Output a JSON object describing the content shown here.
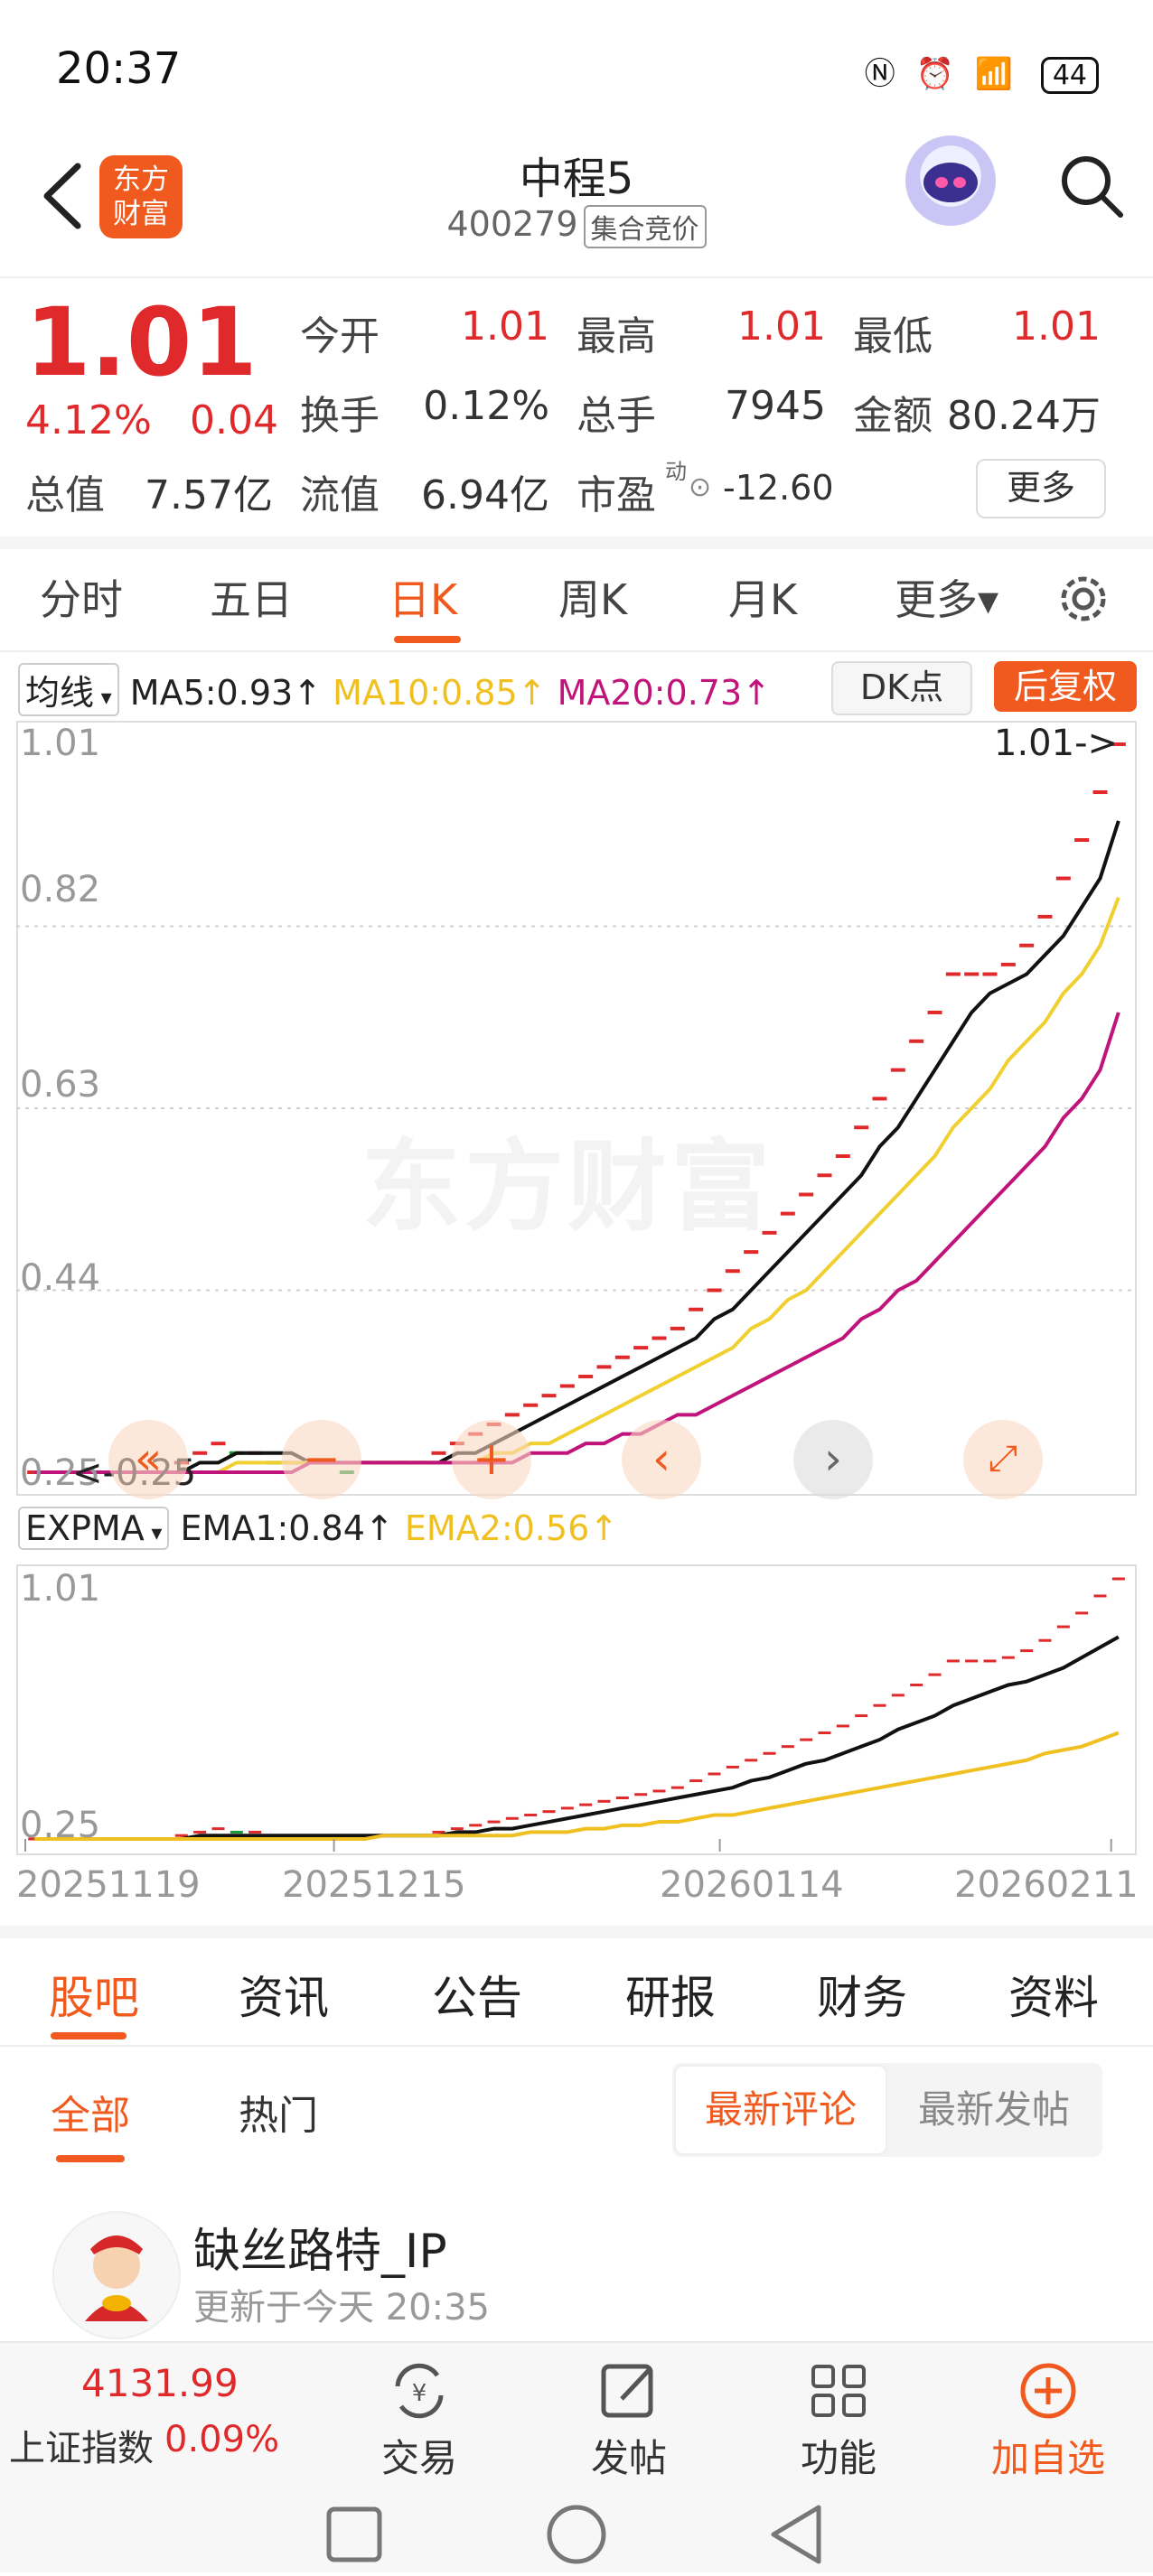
{
  "status_bar": {
    "time": "20:37",
    "battery": "44",
    "icons": [
      "nfc-icon",
      "alarm-icon",
      "wifi-icon",
      "signal-5g-icon",
      "battery-icon"
    ]
  },
  "header": {
    "stock_name": "中程5",
    "stock_code": "400279",
    "auction_tag": "集合竞价",
    "logo_line1": "东方",
    "logo_line2": "财富"
  },
  "quote": {
    "price": "1.01",
    "change_pct": "4.12%",
    "change_amt": "0.04",
    "open_label": "今开",
    "open": "1.01",
    "high_label": "最高",
    "high": "1.01",
    "low_label": "最低",
    "low": "1.01",
    "turnover_label": "换手",
    "turnover": "0.12%",
    "volume_label": "总手",
    "volume": "7945",
    "amount_label": "金额",
    "amount": "80.24万",
    "mktcap_label": "总值",
    "mktcap": "7.57亿",
    "float_label": "流值",
    "float_cap": "6.94亿",
    "pe_label": "市盈",
    "pe_sup": "动",
    "pe": "-12.60",
    "more": "更多"
  },
  "period_tabs": [
    "分时",
    "五日",
    "日K",
    "周K",
    "月K",
    "更多▾"
  ],
  "ma_row": {
    "selector": "均线",
    "ma5": "MA5:0.93↑",
    "ma10": "MA10:0.85↑",
    "ma20": "MA20:0.73↑",
    "dk": "DK点",
    "adjust": "后复权"
  },
  "kline_chart": {
    "y_labels": [
      "1.01",
      "0.82",
      "0.63",
      "0.44",
      "0.25"
    ],
    "last_price_tag": "1.01->",
    "low_tag": "<-0.25",
    "watermark": "东方财富",
    "colors": {
      "up": "#e0292b",
      "down": "#1a9a3a",
      "ma5": "#111111",
      "ma10": "#f0d030",
      "ma20": "#c0147a"
    }
  },
  "expma_row": {
    "selector": "EXPMA",
    "ema1": "EMA1:0.84↑",
    "ema2": "EMA2:0.56↑"
  },
  "expma_chart": {
    "y_labels": [
      "1.01",
      "0.25"
    ],
    "dates": [
      "20251119",
      "20251215",
      "20260114",
      "20260211"
    ],
    "colors": {
      "ema1": "#111111",
      "ema2": "#f0c020"
    }
  },
  "chart_data": {
    "type": "line",
    "title": "",
    "xlabel": "",
    "ylabel": "",
    "ylim": [
      0.25,
      1.01
    ],
    "x_ticks": [
      "20251119",
      "20251215",
      "20260114",
      "20260211"
    ],
    "candles": [
      0.25,
      0.25,
      0.25,
      0.25,
      0.25,
      0.25,
      0.25,
      0.25,
      0.26,
      0.27,
      0.28,
      0.27,
      0.27,
      0.26,
      0.26,
      0.26,
      0.26,
      0.25,
      0.26,
      0.26,
      0.26,
      0.26,
      0.27,
      0.28,
      0.29,
      0.3,
      0.31,
      0.32,
      0.33,
      0.34,
      0.35,
      0.36,
      0.37,
      0.38,
      0.39,
      0.4,
      0.42,
      0.44,
      0.46,
      0.48,
      0.5,
      0.52,
      0.54,
      0.56,
      0.58,
      0.61,
      0.64,
      0.67,
      0.7,
      0.73,
      0.77,
      0.77,
      0.77,
      0.78,
      0.8,
      0.83,
      0.87,
      0.91,
      0.96,
      1.01
    ],
    "series": [
      {
        "name": "MA5",
        "values": [
          0.25,
          0.25,
          0.25,
          0.25,
          0.25,
          0.25,
          0.25,
          0.25,
          0.25,
          0.26,
          0.26,
          0.27,
          0.27,
          0.27,
          0.27,
          0.26,
          0.26,
          0.26,
          0.26,
          0.26,
          0.26,
          0.26,
          0.26,
          0.27,
          0.27,
          0.28,
          0.29,
          0.3,
          0.31,
          0.32,
          0.33,
          0.34,
          0.35,
          0.36,
          0.37,
          0.38,
          0.39,
          0.41,
          0.42,
          0.44,
          0.46,
          0.48,
          0.5,
          0.52,
          0.54,
          0.56,
          0.59,
          0.61,
          0.64,
          0.67,
          0.7,
          0.73,
          0.75,
          0.76,
          0.77,
          0.79,
          0.81,
          0.84,
          0.87,
          0.93
        ]
      },
      {
        "name": "MA10",
        "values": [
          0.25,
          0.25,
          0.25,
          0.25,
          0.25,
          0.25,
          0.25,
          0.25,
          0.25,
          0.25,
          0.25,
          0.26,
          0.26,
          0.26,
          0.26,
          0.26,
          0.26,
          0.26,
          0.26,
          0.26,
          0.26,
          0.26,
          0.26,
          0.26,
          0.26,
          0.27,
          0.27,
          0.28,
          0.28,
          0.29,
          0.3,
          0.31,
          0.32,
          0.33,
          0.34,
          0.35,
          0.36,
          0.37,
          0.38,
          0.4,
          0.41,
          0.43,
          0.44,
          0.46,
          0.48,
          0.5,
          0.52,
          0.54,
          0.56,
          0.58,
          0.61,
          0.63,
          0.65,
          0.68,
          0.7,
          0.72,
          0.75,
          0.77,
          0.8,
          0.85
        ]
      },
      {
        "name": "MA20",
        "values": [
          0.25,
          0.25,
          0.25,
          0.25,
          0.25,
          0.25,
          0.25,
          0.25,
          0.25,
          0.25,
          0.25,
          0.25,
          0.25,
          0.25,
          0.25,
          0.26,
          0.26,
          0.26,
          0.26,
          0.26,
          0.26,
          0.26,
          0.26,
          0.26,
          0.26,
          0.26,
          0.26,
          0.27,
          0.27,
          0.27,
          0.28,
          0.28,
          0.29,
          0.29,
          0.3,
          0.31,
          0.31,
          0.32,
          0.33,
          0.34,
          0.35,
          0.36,
          0.37,
          0.38,
          0.39,
          0.41,
          0.42,
          0.44,
          0.45,
          0.47,
          0.49,
          0.51,
          0.53,
          0.55,
          0.57,
          0.59,
          0.62,
          0.64,
          0.67,
          0.73
        ]
      }
    ],
    "expma": [
      {
        "name": "EMA1",
        "values": [
          0.25,
          0.25,
          0.25,
          0.25,
          0.25,
          0.25,
          0.25,
          0.25,
          0.25,
          0.26,
          0.26,
          0.26,
          0.26,
          0.26,
          0.26,
          0.26,
          0.26,
          0.26,
          0.26,
          0.26,
          0.26,
          0.26,
          0.26,
          0.27,
          0.27,
          0.28,
          0.28,
          0.29,
          0.3,
          0.31,
          0.32,
          0.33,
          0.34,
          0.35,
          0.36,
          0.37,
          0.38,
          0.39,
          0.4,
          0.42,
          0.43,
          0.45,
          0.47,
          0.48,
          0.5,
          0.52,
          0.54,
          0.57,
          0.59,
          0.61,
          0.64,
          0.66,
          0.68,
          0.7,
          0.71,
          0.73,
          0.75,
          0.78,
          0.81,
          0.84
        ]
      },
      {
        "name": "EMA2",
        "values": [
          0.25,
          0.25,
          0.25,
          0.25,
          0.25,
          0.25,
          0.25,
          0.25,
          0.25,
          0.25,
          0.25,
          0.25,
          0.25,
          0.25,
          0.25,
          0.25,
          0.25,
          0.25,
          0.25,
          0.26,
          0.26,
          0.26,
          0.26,
          0.26,
          0.26,
          0.26,
          0.26,
          0.27,
          0.27,
          0.27,
          0.28,
          0.28,
          0.29,
          0.29,
          0.3,
          0.3,
          0.31,
          0.32,
          0.32,
          0.33,
          0.34,
          0.35,
          0.36,
          0.37,
          0.38,
          0.39,
          0.4,
          0.41,
          0.42,
          0.43,
          0.44,
          0.45,
          0.46,
          0.47,
          0.48,
          0.5,
          0.51,
          0.52,
          0.54,
          0.56
        ]
      }
    ]
  },
  "content_tabs": [
    "股吧",
    "资讯",
    "公告",
    "研报",
    "财务",
    "资料"
  ],
  "sub_tabs": {
    "all": "全部",
    "hot": "热门",
    "latest_comment": "最新评论",
    "latest_post": "最新发帖"
  },
  "post": {
    "author": "缺丝路特_IP",
    "time": "更新于今天 20:35"
  },
  "bottom_bar": {
    "index_value": "4131.99",
    "index_name": "上证指数",
    "index_change": "0.09%",
    "items": [
      "交易",
      "发帖",
      "功能",
      "加自选"
    ]
  }
}
